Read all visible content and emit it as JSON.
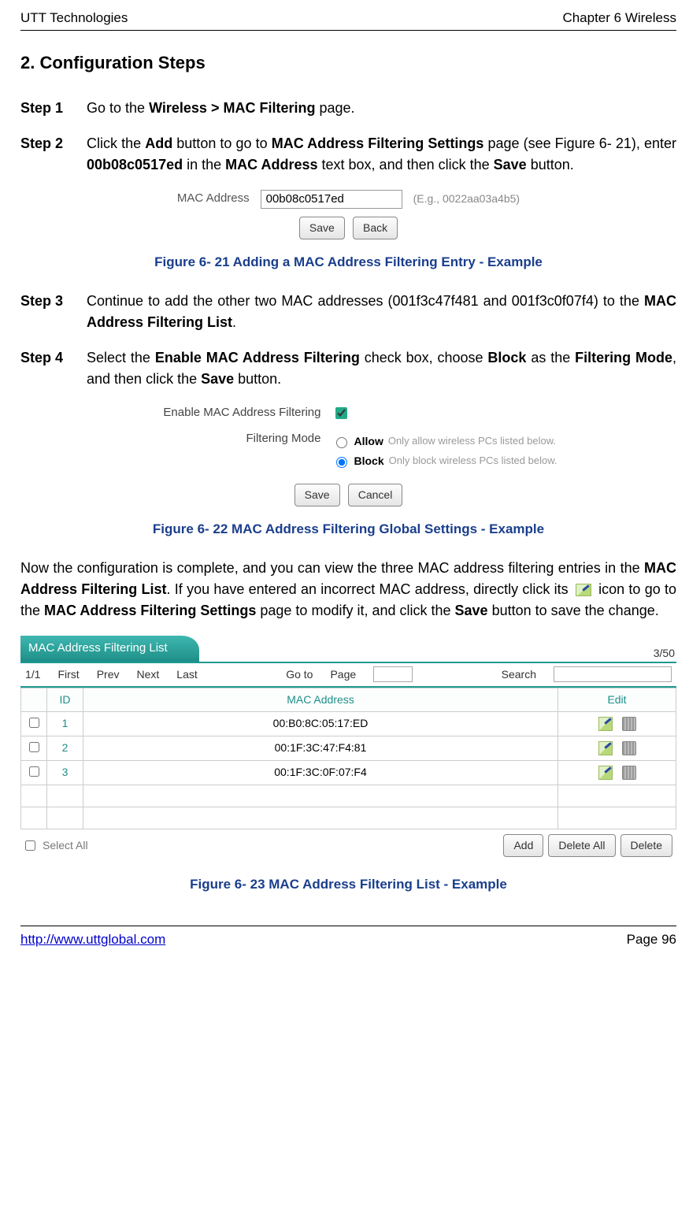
{
  "header": {
    "left": "UTT Technologies",
    "right": "Chapter 6 Wireless"
  },
  "section_title": "2.   Configuration Steps",
  "steps": {
    "s1": {
      "label": "Step 1",
      "t1": "Go to the ",
      "b1": "Wireless > MAC Filtering",
      "t2": " page."
    },
    "s2": {
      "label": "Step 2",
      "t1": "Click the ",
      "b1": "Add",
      "t2": " button to go to ",
      "b2": "MAC Address Filtering Settings",
      "t3": " page (see Figure 6- 21), enter ",
      "b3": "00b08c0517ed",
      "t4": " in the ",
      "b4": "MAC Address",
      "t5": " text box, and then click the ",
      "b5": "Save",
      "t6": " button."
    },
    "s3": {
      "label": "Step 3",
      "t1": "Continue to add the other two MAC addresses (001f3c47f481 and 001f3c0f07f4) to the ",
      "b1": "MAC Address Filtering List",
      "t2": "."
    },
    "s4": {
      "label": "Step 4",
      "t1": "Select the ",
      "b1": "Enable MAC Address Filtering",
      "t2": " check box, choose ",
      "b2": "Block",
      "t3": " as the ",
      "b3": "Filtering Mode",
      "t4": ", and then click the ",
      "b4": "Save",
      "t5": " button."
    }
  },
  "fig21": {
    "mac_label": "MAC Address",
    "mac_value": "00b08c0517ed",
    "hint": "(E.g., 0022aa03a4b5)",
    "save": "Save",
    "back": "Back",
    "caption": "Figure 6- 21 Adding a MAC Address Filtering Entry - Example"
  },
  "fig22": {
    "enable_label": "Enable MAC Address Filtering",
    "mode_label": "Filtering Mode",
    "allow_label": "Allow",
    "allow_desc": "Only allow wireless PCs listed below.",
    "block_label": "Block",
    "block_desc": "Only block wireless PCs listed below.",
    "save": "Save",
    "cancel": "Cancel",
    "caption": "Figure 6- 22 MAC Address Filtering Global Settings - Example"
  },
  "para": {
    "t1": "Now the configuration is complete, and you can view the three MAC address filtering entries in the ",
    "b1": "MAC Address Filtering List",
    "t2": ". If you have entered an incorrect MAC address, directly click its ",
    "t3": " icon to go to the ",
    "b2": "MAC Address Filtering Settings",
    "t4": " page to modify it, and click the ",
    "b3": "Save",
    "t5": " button to save the change."
  },
  "fig23": {
    "title": "MAC Address Filtering List",
    "count": "3/50",
    "pager": {
      "page_pos": "1/1",
      "first": "First",
      "prev": "Prev",
      "next": "Next",
      "last": "Last",
      "goto": "Go to",
      "page": "Page",
      "search": "Search"
    },
    "cols": {
      "id": "ID",
      "mac": "MAC Address",
      "edit": "Edit"
    },
    "rows": [
      {
        "id": "1",
        "mac": "00:B0:8C:05:17:ED"
      },
      {
        "id": "2",
        "mac": "00:1F:3C:47:F4:81"
      },
      {
        "id": "3",
        "mac": "00:1F:3C:0F:07:F4"
      }
    ],
    "select_all": "Select All",
    "add": "Add",
    "delete_all": "Delete All",
    "delete": "Delete",
    "caption": "Figure 6- 23 MAC Address Filtering List - Example"
  },
  "footer": {
    "url": "http://www.uttglobal.com",
    "page": "Page 96"
  }
}
